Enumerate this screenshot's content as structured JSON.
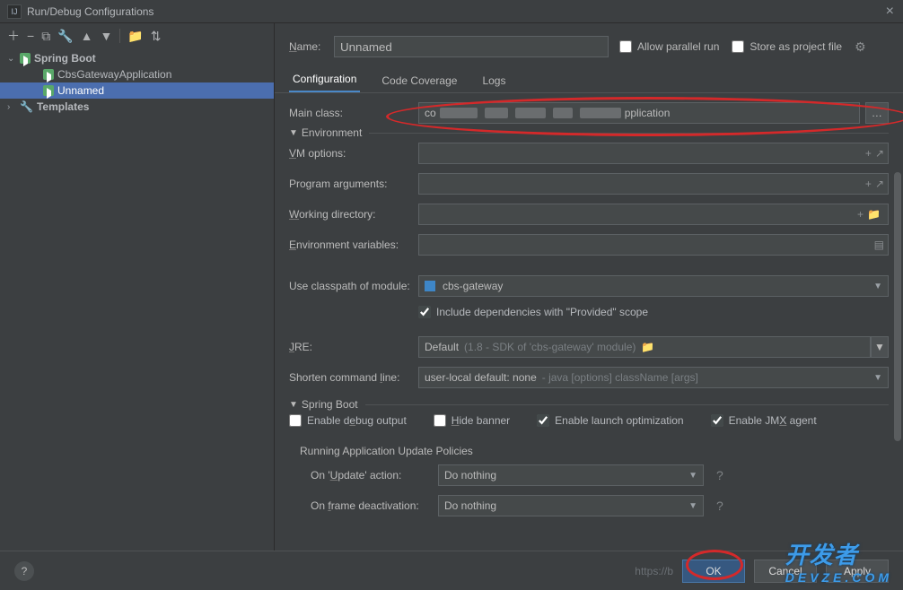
{
  "title": "Run/Debug Configurations",
  "sidebar": {
    "springBoot": "Spring Boot",
    "app1": "CbsGatewayApplication",
    "app2": "Unnamed",
    "templates": "Templates"
  },
  "header": {
    "nameLabel": "Name:",
    "nameValue": "Unnamed",
    "allowParallel": "Allow parallel run",
    "storeProject": "Store as project file"
  },
  "tabs": {
    "configuration": "Configuration",
    "codeCoverage": "Code Coverage",
    "logs": "Logs"
  },
  "form": {
    "mainClassLabel": "Main class:",
    "mainClassPrefix": "co",
    "mainClassSuffix": "pplication",
    "envHeader": "Environment",
    "vmOptions": "VM options:",
    "programArgs": "Program arguments:",
    "workingDir": "Working directory:",
    "envVars": "Environment variables:",
    "classpathLabel": "Use classpath of module:",
    "classpathValue": "cbs-gateway",
    "includeProvided": "Include dependencies with \"Provided\" scope",
    "jreLabel": "JRE:",
    "jreValue": "Default",
    "jreHint": "(1.8 - SDK of 'cbs-gateway' module)",
    "shortenLabel": "Shorten command line:",
    "shortenValue": "user-local default: none",
    "shortenHint": " - java [options] className [args]",
    "springHeader": "Spring Boot",
    "enableDebug": "Enable debug output",
    "hideBanner": "Hide banner",
    "enableLaunch": "Enable launch optimization",
    "enableJmx": "Enable JMX agent",
    "updatePolicies": "Running Application Update Policies",
    "onUpdateLabel": "On 'Update' action:",
    "onUpdateValue": "Do nothing",
    "onFrameLabel": "On frame deactivation:",
    "onFrameValue": "Do nothing"
  },
  "footer": {
    "ok": "OK",
    "cancel": "Cancel",
    "apply": "Apply",
    "url": "https://b"
  },
  "watermark": {
    "main": "开发者",
    "sub": "DEVZE.COM"
  }
}
